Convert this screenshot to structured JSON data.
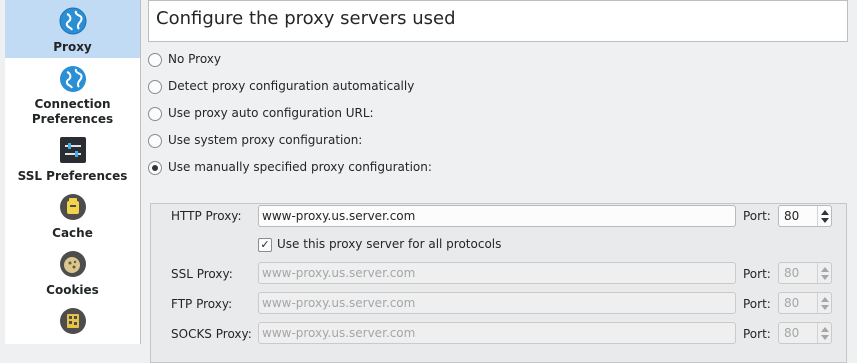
{
  "sidebar": {
    "items": [
      {
        "label": "Proxy",
        "icon": "globe-icon",
        "selected": true
      },
      {
        "label": "Connection Preferences",
        "icon": "globe-icon"
      },
      {
        "label": "SSL Preferences",
        "icon": "sliders-icon"
      },
      {
        "label": "Cache",
        "icon": "cache-icon"
      },
      {
        "label": "Cookies",
        "icon": "cookie-icon"
      },
      {
        "label": "",
        "icon": "browser-id-icon"
      }
    ]
  },
  "header": {
    "title": "Configure the proxy servers used"
  },
  "modes": [
    {
      "label": "No Proxy",
      "checked": false
    },
    {
      "label": "Detect proxy configuration automatically",
      "checked": false
    },
    {
      "label": "Use proxy auto configuration URL:",
      "checked": false
    },
    {
      "label": "Use system proxy configuration:",
      "checked": false
    },
    {
      "label": "Use manually specified proxy configuration:",
      "checked": true
    }
  ],
  "manual": {
    "port_label": "Port:",
    "use_for_all": {
      "label": "Use this proxy server for all protocols",
      "checked": true
    },
    "http": {
      "label": "HTTP Proxy:",
      "value": "www-proxy.us.server.com",
      "port": "80"
    },
    "ssl": {
      "label": "SSL Proxy:",
      "value": "www-proxy.us.server.com",
      "port": "80"
    },
    "ftp": {
      "label": "FTP Proxy:",
      "value": "www-proxy.us.server.com",
      "port": "80"
    },
    "socks": {
      "label": "SOCKS Proxy:",
      "value": "www-proxy.us.server.com",
      "port": "80"
    }
  },
  "colors": {
    "selection": "#c1dbf5",
    "window_bg": "#eff0f1",
    "globe_blue": "#2b8fd6"
  }
}
